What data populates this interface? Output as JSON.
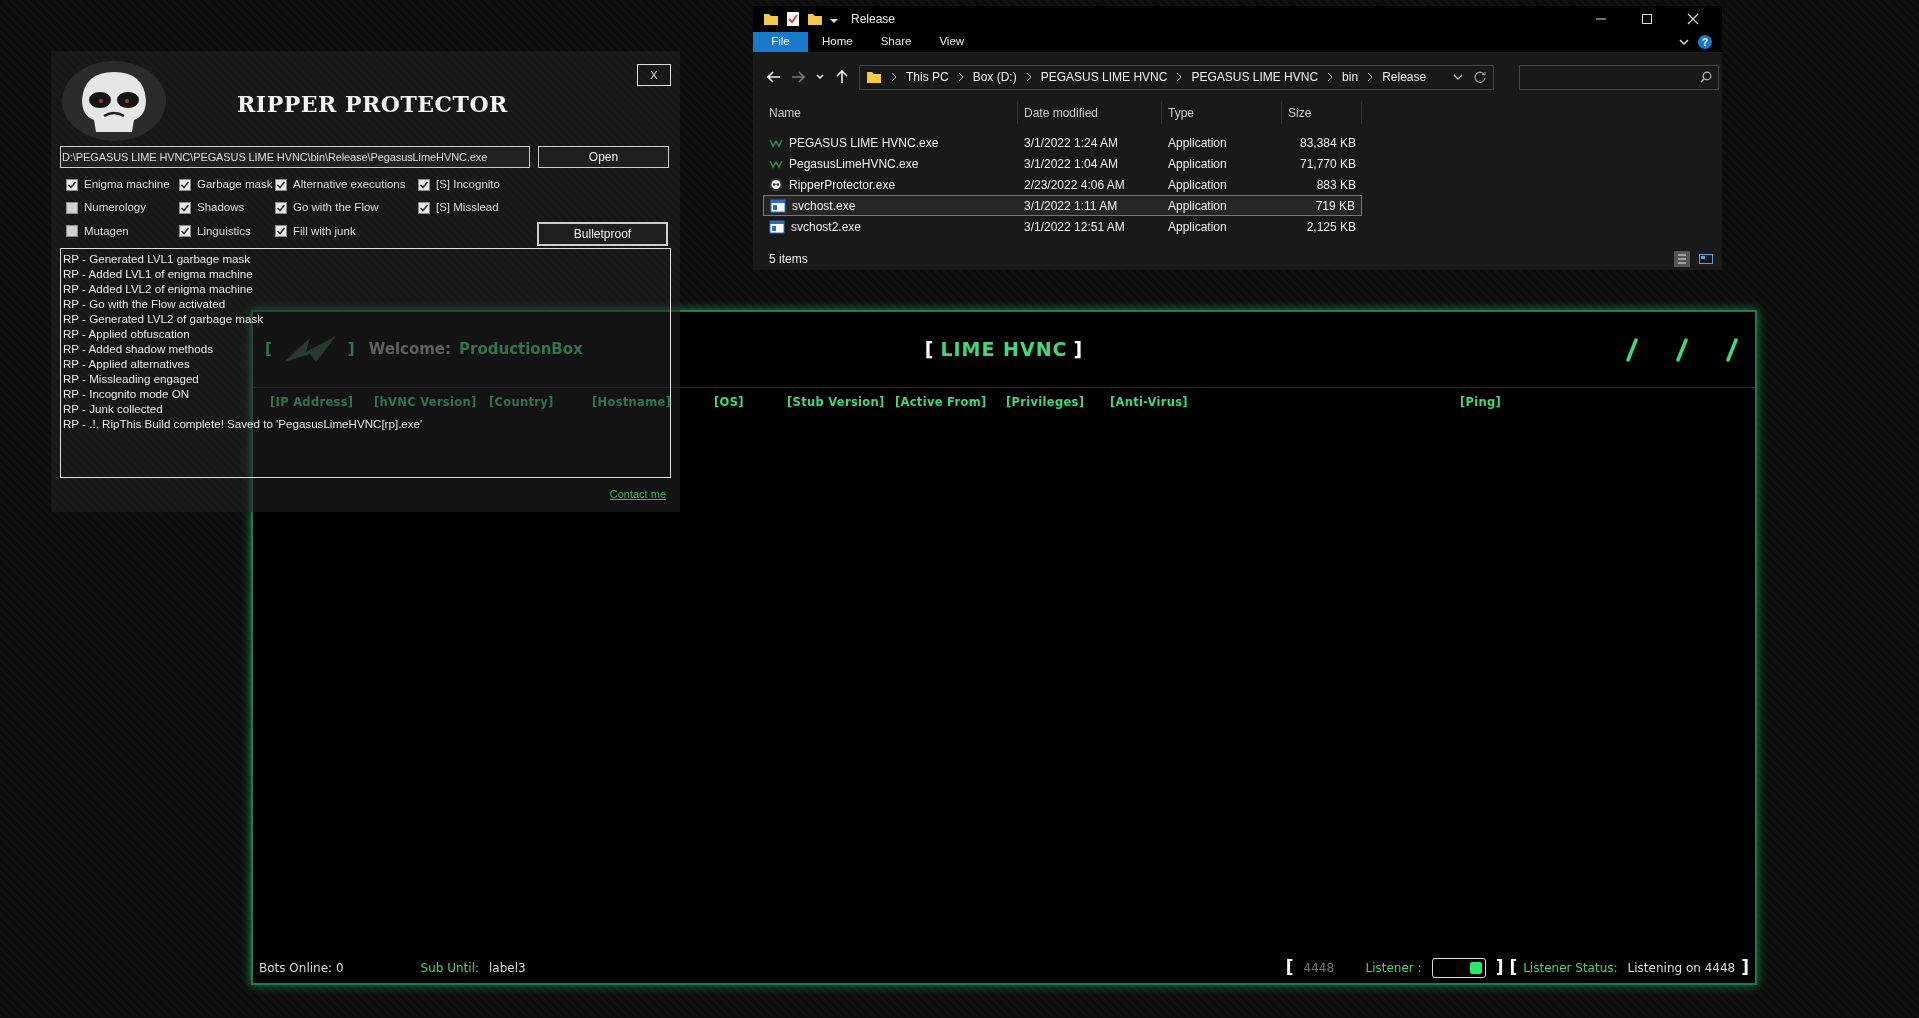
{
  "ripper": {
    "title": "RIPPER PROTECTOR",
    "close": "X",
    "path": "D:\\PEGASUS LIME HVNC\\PEGASUS LIME HVNC\\bin\\Release\\PegasusLimeHVNC.exe",
    "open_button": "Open",
    "options": [
      {
        "label": "Enigma machine",
        "checked": true
      },
      {
        "label": "Garbage mask",
        "checked": true
      },
      {
        "label": "Alternative executions",
        "checked": true
      },
      {
        "label": "[S] Incognito",
        "checked": true
      },
      {
        "label": "Numerology",
        "checked": false
      },
      {
        "label": "Shadows",
        "checked": true
      },
      {
        "label": "Go with the Flow",
        "checked": true
      },
      {
        "label": "[S] Misslead",
        "checked": true
      },
      {
        "label": "Mutagen",
        "checked": false
      },
      {
        "label": "Linguistics",
        "checked": true
      },
      {
        "label": "Fill with junk",
        "checked": true
      }
    ],
    "bulletproof_button": "Bulletproof",
    "log": [
      "RP - Generated LVL1 garbage mask",
      "RP - Added LVL1 of enigma machine",
      "RP - Added LVL2 of enigma machine",
      "RP - Go with the Flow activated",
      "RP - Generated LVL2 of garbage mask",
      "RP - Applied obfuscation",
      "RP - Added shadow methods",
      "RP - Applied alternatives",
      "RP - Missleading engaged",
      "RP - Incognito mode ON",
      "RP - Junk collected",
      "RP - .!. RipThis Build complete! Saved to 'PegasusLimeHVNC[rp].exe'"
    ],
    "contact_link": "Contact me"
  },
  "explorer": {
    "title": "Release",
    "tabs": [
      {
        "label": "File",
        "selected": true
      },
      {
        "label": "Home",
        "selected": false
      },
      {
        "label": "Share",
        "selected": false
      },
      {
        "label": "View",
        "selected": false
      }
    ],
    "help": "?",
    "breadcrumb": [
      "This PC",
      "Box (D:)",
      "PEGASUS LIME HVNC",
      "PEGASUS LIME HVNC",
      "bin",
      "Release"
    ],
    "columns": [
      "Name",
      "Date modified",
      "Type",
      "Size"
    ],
    "files": [
      {
        "name": "PEGASUS LIME HVNC.exe",
        "date": "3/1/2022 1:24 AM",
        "type": "Application",
        "size": "83,384 KB",
        "kind": "hvnc",
        "selected": false
      },
      {
        "name": "PegasusLimeHVNC.exe",
        "date": "3/1/2022 1:04 AM",
        "type": "Application",
        "size": "71,770 KB",
        "kind": "hvnc",
        "selected": false
      },
      {
        "name": "RipperProtector.exe",
        "date": "2/23/2022 4:06 AM",
        "type": "Application",
        "size": "883 KB",
        "kind": "skull",
        "selected": false
      },
      {
        "name": "svchost.exe",
        "date": "3/1/2022 1:11 AM",
        "type": "Application",
        "size": "719 KB",
        "kind": "app",
        "selected": true
      },
      {
        "name": "svchost2.exe",
        "date": "3/1/2022 12:51 AM",
        "type": "Application",
        "size": "2,125 KB",
        "kind": "app",
        "selected": false
      }
    ],
    "status": "5 items"
  },
  "hvnc": {
    "logo_open": "[",
    "logo_close": "]",
    "welcome_label": "Welcome:",
    "username": "ProductionBox",
    "title_open": "[",
    "title": "LIME HVNC",
    "title_close": "]",
    "columns": [
      "[IP Address]",
      "[hVNC Version]",
      "[Country]",
      "[Hostname]",
      "[OS]",
      "[Stub Version]",
      "[Active From]",
      "[Privileges]",
      "[Anti-Virus]",
      "[Ping]"
    ],
    "footer": {
      "bots_online": "Bots Online: 0",
      "sub_until_label": "Sub Until:",
      "sub_until_value": "label3",
      "port_open": "[",
      "port": "4448",
      "listener_label": "Listener :",
      "listener_on": true,
      "port_close": "]",
      "status_open": "[",
      "status_label": "Listener Status:",
      "status_value": "Listening on 4448",
      "status_close": "]"
    }
  }
}
